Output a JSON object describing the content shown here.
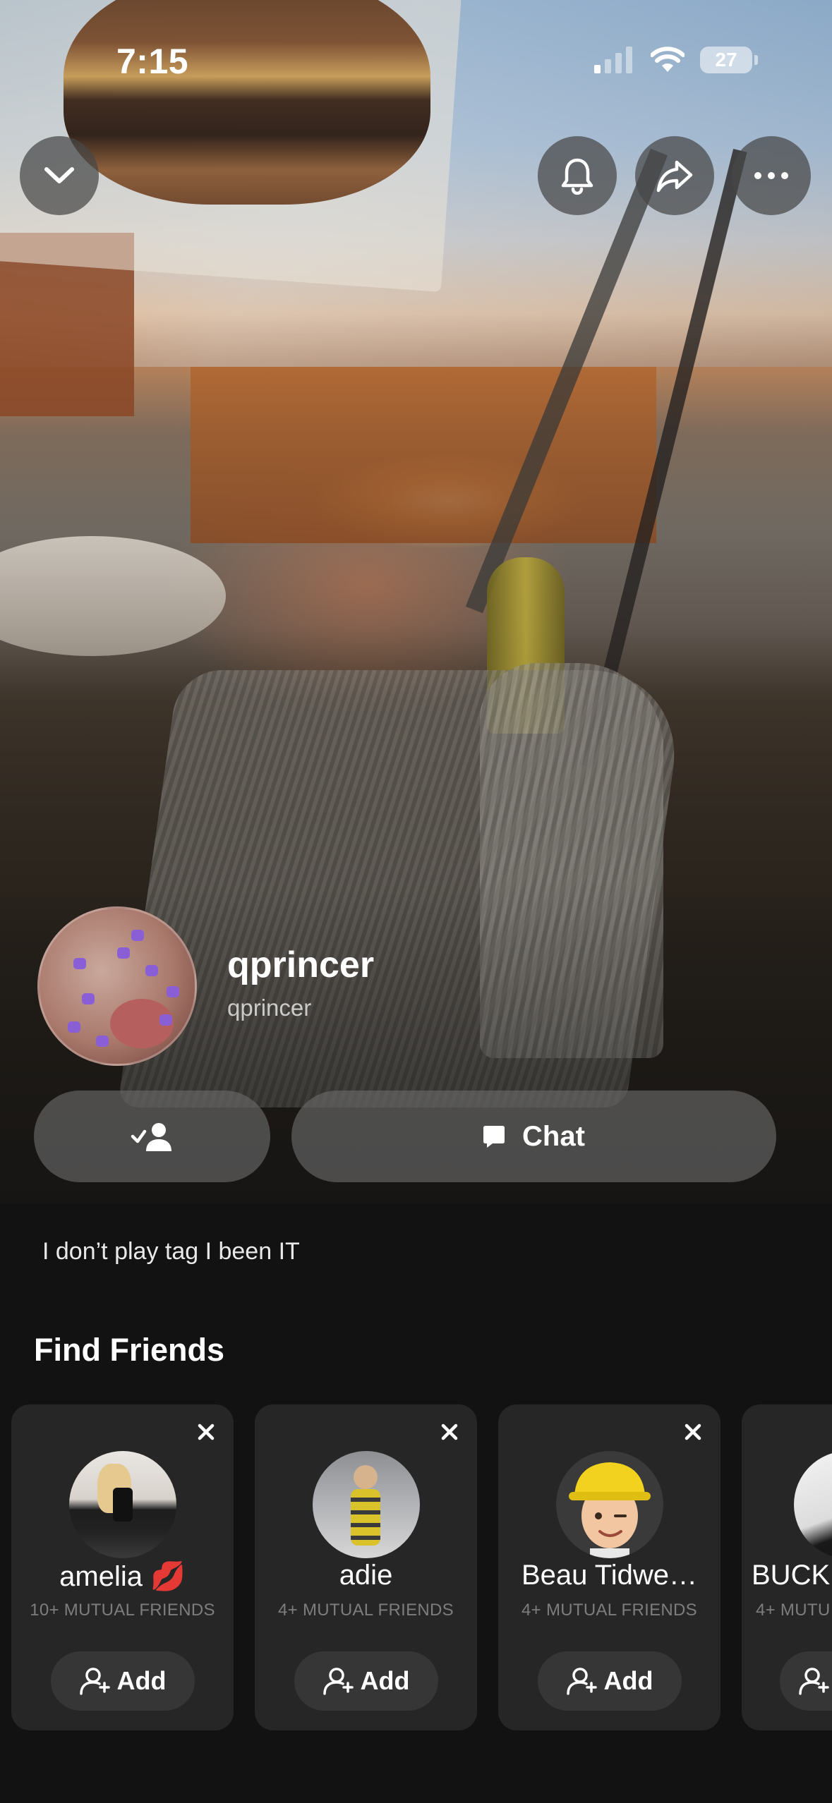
{
  "status_bar": {
    "time": "7:15",
    "battery": "27"
  },
  "top_buttons": {
    "collapse": "chevron-down-icon",
    "notifications": "bell-icon",
    "share": "share-arrow-icon",
    "more": "more-icon"
  },
  "profile": {
    "display_name": "qprincer",
    "username": "qprincer"
  },
  "actions": {
    "friend_icon": "friend-check-icon",
    "chat_label": "Chat"
  },
  "bio": "I don’t play tag I been IT",
  "find_friends": {
    "title": "Find Friends",
    "cards": [
      {
        "name": "amelia 💋",
        "mutual": "10+ MUTUAL FRIENDS",
        "add_label": "Add"
      },
      {
        "name": "adie",
        "mutual": "4+ MUTUAL FRIENDS",
        "add_label": "Add"
      },
      {
        "name": "Beau Tidwe…",
        "mutual": "4+ MUTUAL FRIENDS",
        "add_label": "Add"
      },
      {
        "name": "BUCK",
        "mutual": "4+ MUTU",
        "add_label": ""
      }
    ]
  },
  "colors": {
    "background": "#121212",
    "card": "#262626",
    "pill": "#696969",
    "muted_text": "#7d7d7d"
  }
}
